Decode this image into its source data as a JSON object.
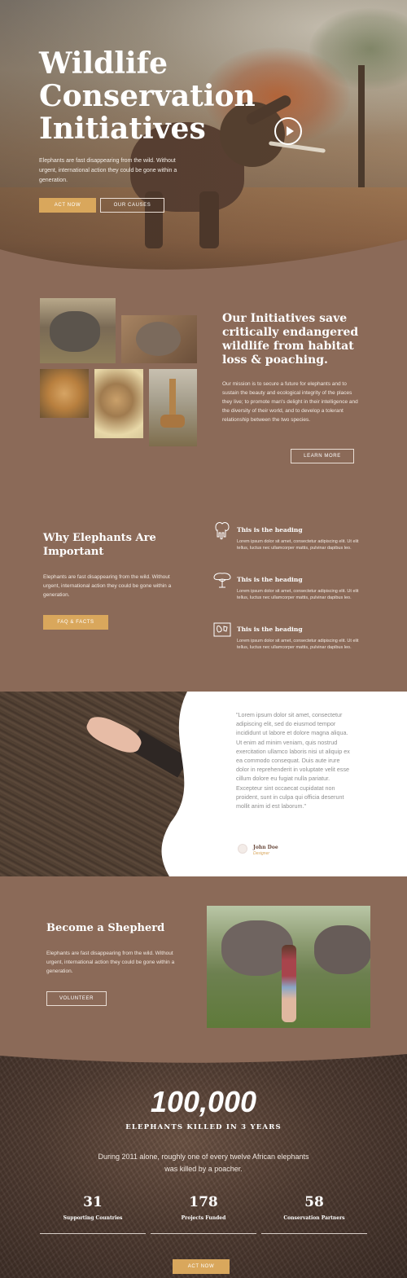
{
  "hero": {
    "title": "Wildlife Conservation Initiatives",
    "text": "Elephants are fast disappearing from the wild. Without urgent, international action they could be gone within a generation.",
    "primary_button": "ACT NOW",
    "secondary_button": "OUR CAUSES"
  },
  "initiatives": {
    "title": "Our Initiatives save critically endangered wildlife from habitat loss & poaching.",
    "text": "Our mission is to secure a future for elephants and to sustain the beauty and ecological integrity of the places they live; to promote man's delight in their intelligence and the diversity of their world, and to develop a tolerant relationship between the two species.",
    "button": "LEARN MORE"
  },
  "why": {
    "title": "Why Elephants Are Important",
    "text": "Elephants are fast disappearing from the wild. Without urgent, international action they could be gone within a generation.",
    "button": "FAQ & FACTS",
    "features": [
      {
        "heading": "This is the heading",
        "body": "Lorem ipsum dolor sit amet, consectetur adipiscing elit. Ut elit tellus, luctus nec ullamcorper mattis, pulvinar dapibus leo.",
        "icon": "elephant-icon"
      },
      {
        "heading": "This is the heading",
        "body": "Lorem ipsum dolor sit amet, consectetur adipiscing elit. Ut elit tellus, luctus nec ullamcorper mattis, pulvinar dapibus leo.",
        "icon": "tree-icon"
      },
      {
        "heading": "This is the heading",
        "body": "Lorem ipsum dolor sit amet, consectetur adipiscing elit. Ut elit tellus, luctus nec ullamcorper mattis, pulvinar dapibus leo.",
        "icon": "map-icon"
      }
    ]
  },
  "testimonial": {
    "quote": "\"Lorem ipsum dolor sit amet, consectetur adipiscing elit, sed do eiusmod tempor incididunt ut labore et dolore magna aliqua. Ut enim ad minim veniam, quis nostrud exercitation ullamco laboris nisi ut aliquip ex ea commodo consequat. Duis aute irure dolor in reprehenderit in voluptate velit esse cillum dolore eu fugiat nulla pariatur. Excepteur sint occaecat cupidatat non proident, sunt in culpa qui officia deserunt mollit anim id est laborum.\"",
    "name": "John Doe",
    "role": "Designer"
  },
  "shepherd": {
    "title": "Become a Shepherd",
    "text": "Elephants are fast disappearing from the wild. Without urgent, international action they could be gone within a generation.",
    "button": "VOLUNTEER"
  },
  "stats": {
    "big_number": "100,000",
    "big_label": "ELEPHANTS KILLED IN 3 YEARS",
    "text": "During 2011 alone, roughly one of every twelve African elephants was killed by a poacher.",
    "items": [
      {
        "value": "31",
        "label": "Supporting Countries"
      },
      {
        "value": "178",
        "label": "Projects Funded"
      },
      {
        "value": "58",
        "label": "Conservation Partners"
      }
    ],
    "button": "ACT NOW"
  },
  "colors": {
    "section_bg": "#8b6a58",
    "accent_gold": "#d9a75c",
    "white": "#ffffff"
  }
}
